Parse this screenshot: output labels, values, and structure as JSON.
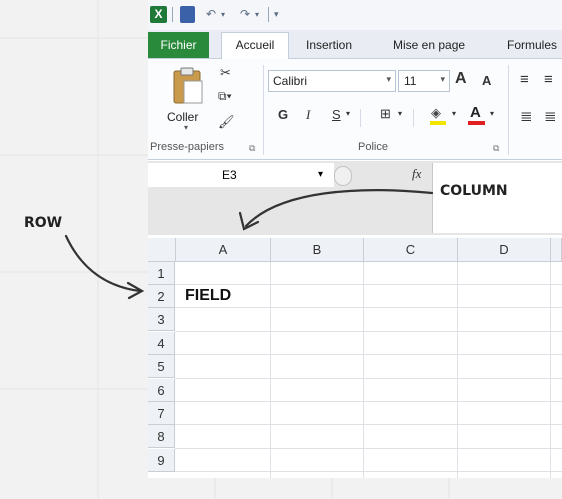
{
  "qat": {
    "undo_icon": "undo-icon",
    "redo_icon": "redo-icon"
  },
  "tabs": [
    "Fichier",
    "Accueil",
    "Insertion",
    "Mise en page",
    "Formules"
  ],
  "ribbon": {
    "paste_label": "Coller",
    "clipboard_group": "Presse-papiers",
    "font_group": "Police",
    "font_name": "Calibri",
    "font_size": "11",
    "bold": "G",
    "italic": "I",
    "underline": "S",
    "increase_font": "A",
    "decrease_font": "A",
    "font_color": "A"
  },
  "formula_bar": {
    "name_box": "E3",
    "fx": "fx",
    "content": ""
  },
  "grid": {
    "columns": [
      "A",
      "B",
      "C",
      "D"
    ],
    "rows": [
      "1",
      "2",
      "3",
      "4",
      "5",
      "6",
      "7",
      "8",
      "9"
    ],
    "cell_A2": "FIELD"
  },
  "annotations": {
    "row": "ROW",
    "column": "COLUMN"
  },
  "colors": {
    "file_tab": "#2a8a3c",
    "header_bg": "#eef1f5",
    "font_color_bar": "#e02020",
    "highlight_bar": "#f2e600"
  }
}
